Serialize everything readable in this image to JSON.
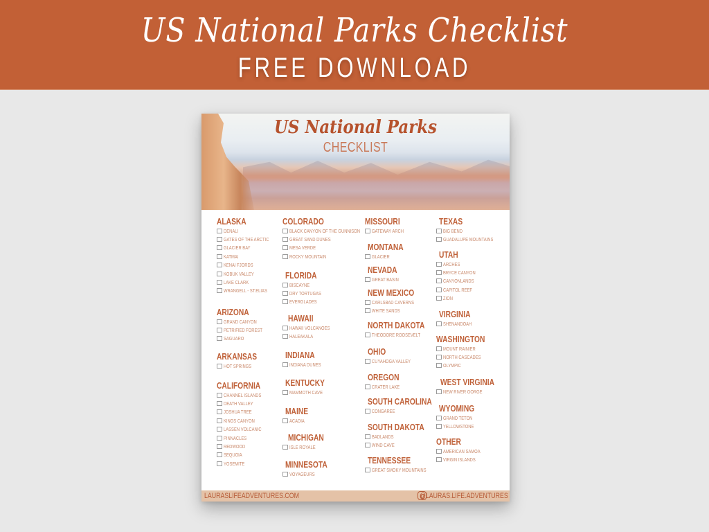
{
  "banner": {
    "title": "US National Parks Checklist",
    "subtitle": "FREE DOWNLOAD",
    "color": "#c26036"
  },
  "sheet": {
    "title": "US National Parks",
    "subtitle": "CHECKLIST",
    "columns": [
      [
        {
          "state": "ALASKA",
          "parks": [
            "DENALI",
            "GATES OF THE ARCTIC",
            "GLACIER BAY",
            "KATMAI",
            "KENAI FJORDS",
            "KOBUK VALLEY",
            "LAKE CLARK",
            "WRANGELL - ST.ELIAS"
          ]
        },
        {
          "state": "ARIZONA",
          "parks": [
            "GRAND CANYON",
            "PETRIFIED FOREST",
            "SAGUARO"
          ]
        },
        {
          "state": "ARKANSAS",
          "parks": [
            "HOT SPRINGS"
          ]
        },
        {
          "state": "CALIFORNIA",
          "parks": [
            "CHANNEL ISLANDS",
            "DEATH VALLEY",
            "JOSHUA TREE",
            "KINGS CANYON",
            "LASSEN VOLCANIC",
            "PINNACLES",
            "REDWOOD",
            "SEQUOIA",
            "YOSEMITE"
          ]
        }
      ],
      [
        {
          "state": "COLORADO",
          "parks": [
            "BLACK CANYON OF THE GUNNISON",
            "GREAT SAND DUNES",
            "MESA VERDE",
            "ROCKY MOUNTAIN"
          ]
        },
        {
          "state": "FLORIDA",
          "parks": [
            "BISCAYNE",
            "DRY TORTUGAS",
            "EVERGLADES"
          ]
        },
        {
          "state": "HAWAII",
          "parks": [
            "HAWAII VOLCANOES",
            "HALEAKALA"
          ]
        },
        {
          "state": "INDIANA",
          "parks": [
            "INDIANA DUNES"
          ]
        },
        {
          "state": "KENTUCKY",
          "parks": [
            "MAMMOTH CAVE"
          ]
        },
        {
          "state": "MAINE",
          "parks": [
            "ACADIA"
          ]
        },
        {
          "state": "MICHIGAN",
          "parks": [
            "ISLE ROYALE"
          ]
        },
        {
          "state": "MINNESOTA",
          "parks": [
            "VOYAGEURS"
          ]
        }
      ],
      [
        {
          "state": "MISSOURI",
          "parks": [
            "GATEWAY ARCH"
          ]
        },
        {
          "state": "MONTANA",
          "parks": [
            "GLACIER"
          ]
        },
        {
          "state": "NEVADA",
          "parks": [
            "GREAT BASIN"
          ]
        },
        {
          "state": "NEW MEXICO",
          "parks": [
            "CARLSBAD CAVERNS",
            "WHITE SANDS"
          ]
        },
        {
          "state": "NORTH DAKOTA",
          "parks": [
            "THEODORE ROOSEVELT"
          ]
        },
        {
          "state": "OHIO",
          "parks": [
            "CUYAHOGA VALLEY"
          ]
        },
        {
          "state": "OREGON",
          "parks": [
            "CRATER LAKE"
          ]
        },
        {
          "state": "SOUTH CAROLINA",
          "parks": [
            "CONGAREE"
          ]
        },
        {
          "state": "SOUTH DAKOTA",
          "parks": [
            "BADLANDS",
            "WIND CAVE"
          ]
        },
        {
          "state": "TENNESSEE",
          "parks": [
            "GREAT SMOKY MOUNTAINS"
          ]
        }
      ],
      [
        {
          "state": "TEXAS",
          "parks": [
            "BIG BEND",
            "GUADALUPE MOUNTAINS"
          ]
        },
        {
          "state": "UTAH",
          "parks": [
            "ARCHES",
            "BRYCE CANYON",
            "CANYONLANDS",
            "CAPITOL REEF",
            "ZION"
          ]
        },
        {
          "state": "VIRGINIA",
          "parks": [
            "SHENANDOAH"
          ]
        },
        {
          "state": "WASHINGTON",
          "parks": [
            "MOUNT RAINIER",
            "NORTH CASCADES",
            "OLYMPIC"
          ]
        },
        {
          "state": "WEST VIRGINIA",
          "parks": [
            "NEW RIVER GORGE"
          ]
        },
        {
          "state": "WYOMING",
          "parks": [
            "GRAND TETON",
            "YELLOWSTONE"
          ]
        },
        {
          "state": "OTHER",
          "parks": [
            "AMERICAN SAMOA",
            "VIRGIN ISLANDS"
          ]
        }
      ]
    ],
    "footer": {
      "website": "LAURASLIFEADVENTURES.COM",
      "instagram_icon": "instagram-icon",
      "handle": "@LAURAS.LIFE.ADVENTURES"
    }
  }
}
